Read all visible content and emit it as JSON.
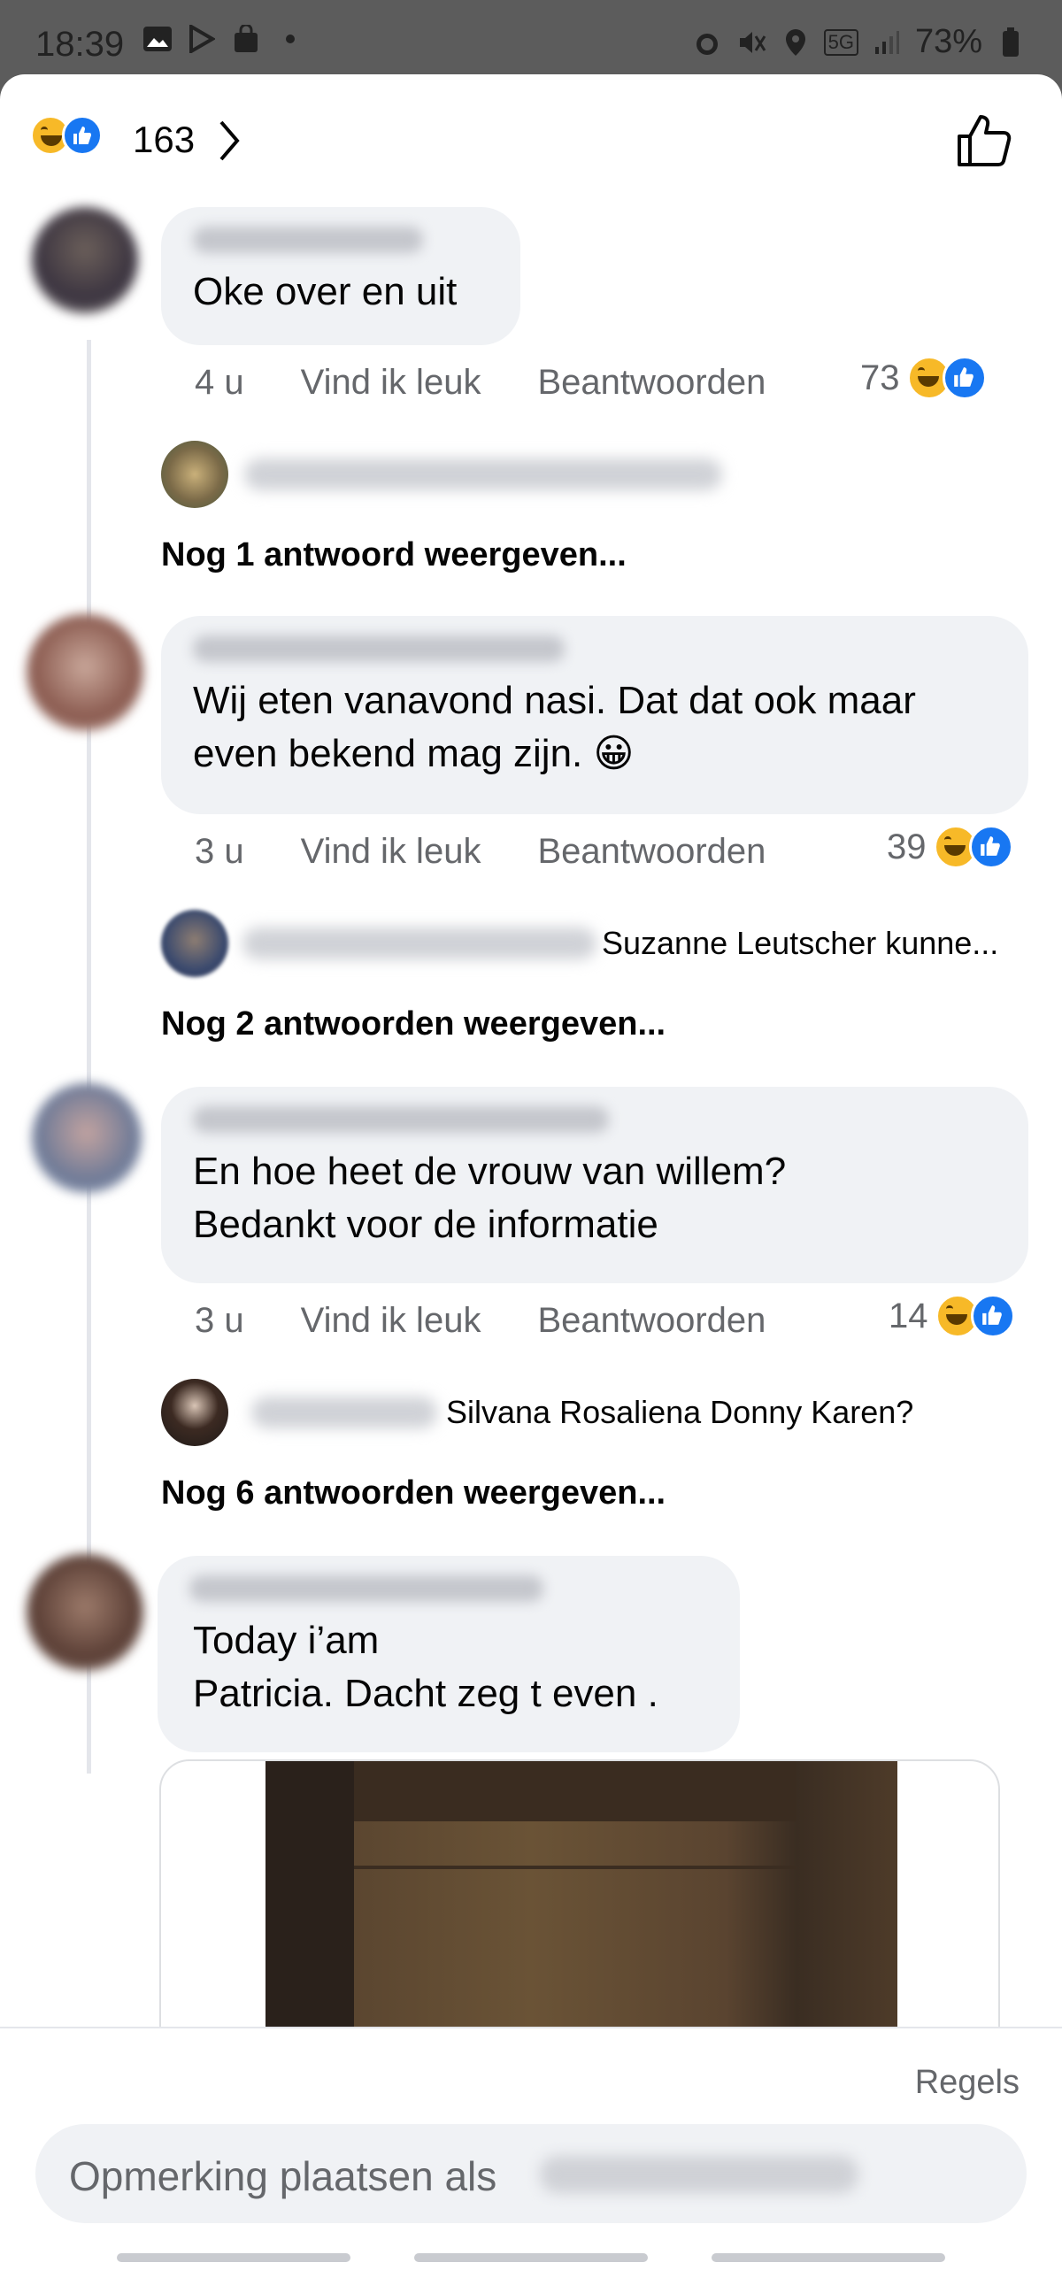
{
  "status_bar": {
    "time": "18:39",
    "network": "5G",
    "battery": "73%"
  },
  "header": {
    "reaction_count": "163"
  },
  "comments": [
    {
      "text": "Oke over en uit",
      "time": "4 u",
      "like_label": "Vind ik leuk",
      "reply_label": "Beantwoorden",
      "reactions": "73",
      "reply_preview": "",
      "more_replies": "Nog 1 antwoord weergeven..."
    },
    {
      "text": "Wij eten vanavond nasi. Dat dat ook maar\neven bekend mag zijn. 😀",
      "time": "3 u",
      "like_label": "Vind ik leuk",
      "reply_label": "Beantwoorden",
      "reactions": "39",
      "reply_preview": "Suzanne Leutscher kunne...",
      "more_replies": "Nog 2 antwoorden weergeven..."
    },
    {
      "text": "En hoe heet de vrouw van willem?\nBedankt voor de informatie",
      "time": "3 u",
      "like_label": "Vind ik leuk",
      "reply_label": "Beantwoorden",
      "reactions": "14",
      "reply_preview": "Silvana Rosaliena Donny Karen?",
      "more_replies": "Nog 6 antwoorden weergeven..."
    },
    {
      "text": "Today i’am\nPatricia. Dacht zeg t even ."
    }
  ],
  "footer": {
    "rules_label": "Regels",
    "composer_placeholder": "Opmerking plaatsen als"
  }
}
